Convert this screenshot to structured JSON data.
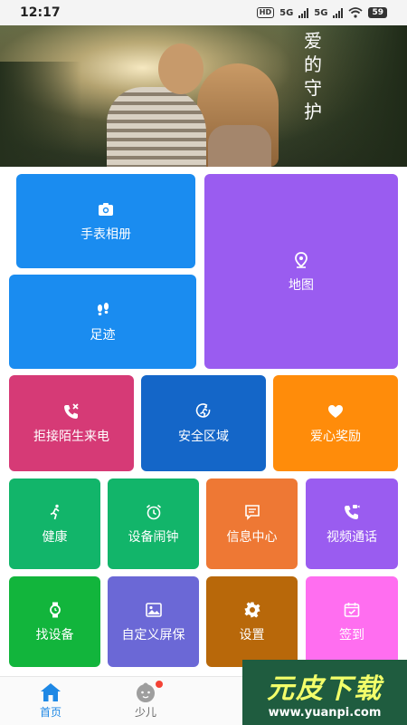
{
  "status": {
    "time": "12:17",
    "hd": "HD",
    "net1": "5G",
    "net2": "5G",
    "battery": "59"
  },
  "banner": {
    "text": "爱的守护"
  },
  "tiles": {
    "album": {
      "label": "手表相册",
      "icon": "camera-icon",
      "color": "#1a8cf0"
    },
    "map": {
      "label": "地图",
      "icon": "location-pin-icon",
      "color": "#9a5cf0"
    },
    "footprint": {
      "label": "足迹",
      "icon": "footprints-icon",
      "color": "#1a8cf0"
    },
    "reject_calls": {
      "label": "拒接陌生来电",
      "icon": "phone-blocked-icon",
      "color": "#d63a76"
    },
    "safe_zone": {
      "label": "安全区域",
      "icon": "shield-runner-icon",
      "color": "#1466c8"
    },
    "love_reward": {
      "label": "爱心奖励",
      "icon": "heart-icon",
      "color": "#ff8c0a"
    },
    "health": {
      "label": "健康",
      "icon": "running-icon",
      "color": "#12b56a"
    },
    "alarm": {
      "label": "设备闹钟",
      "icon": "alarm-clock-icon",
      "color": "#12b56a"
    },
    "messages": {
      "label": "信息中心",
      "icon": "message-icon",
      "color": "#ee7834"
    },
    "video_call": {
      "label": "视频通话",
      "icon": "video-call-icon",
      "color": "#9a5cf0"
    },
    "find_device": {
      "label": "找设备",
      "icon": "watch-icon",
      "color": "#12b53c"
    },
    "screensaver": {
      "label": "自定义屏保",
      "icon": "image-icon",
      "color": "#6b68d6"
    },
    "settings": {
      "label": "设置",
      "icon": "gear-icon",
      "color": "#b8680a"
    },
    "checkin": {
      "label": "签到",
      "icon": "calendar-check-icon",
      "color": "#ff6ef0"
    }
  },
  "nav": {
    "home_label": "首页",
    "child_label": "少儿"
  },
  "watermark": {
    "title": "元皮下载",
    "url": "www.yuanpi.com"
  }
}
